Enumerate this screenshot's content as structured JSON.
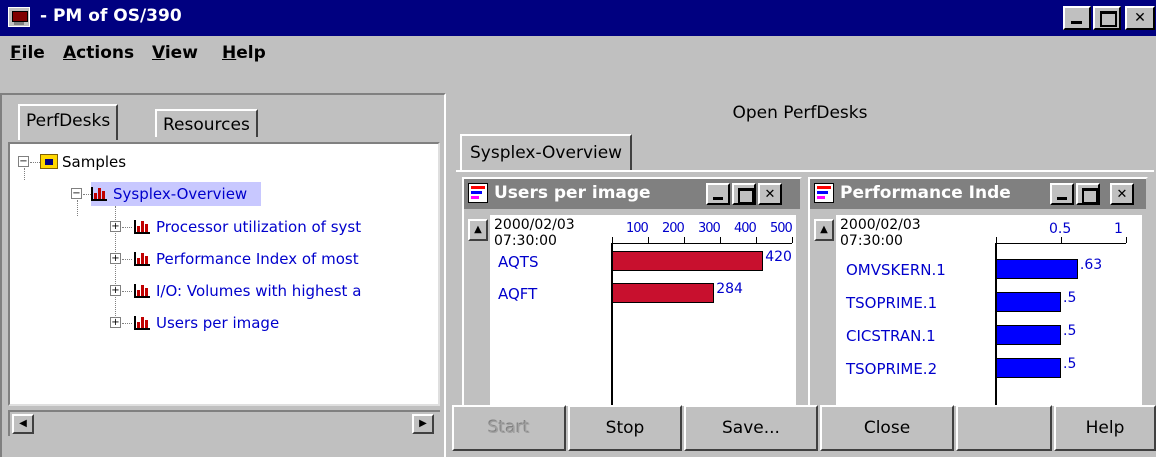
{
  "window": {
    "title": "- PM of OS/390"
  },
  "menu": [
    {
      "key": "F",
      "rest": "ile"
    },
    {
      "key": "A",
      "rest": "ctions"
    },
    {
      "key": "V",
      "rest": "iew"
    },
    {
      "key": "H",
      "rest": "elp"
    }
  ],
  "left": {
    "tabs": [
      "PerfDesks",
      "Resources"
    ],
    "tree": {
      "root": "Samples",
      "desk": "Sysplex-Overview",
      "items": [
        "Processor utilization of syst",
        "Performance Index of most",
        "I/O: Volumes with highest a",
        "Users per image"
      ]
    }
  },
  "right": {
    "title": "Open PerfDesks",
    "tab": "Sysplex-Overview",
    "charts": [
      {
        "title": "Users per image",
        "timestamp_date": "2000/02/03",
        "timestamp_time": "07:30:00",
        "tick_labels": [
          "100",
          "200",
          "300",
          "400",
          "500"
        ],
        "bar_color": "#c8102e"
      },
      {
        "title": "Performance Inde",
        "timestamp_date": "2000/02/03",
        "timestamp_time": "07:30:00",
        "tick_labels": [
          "0.5",
          "1"
        ],
        "bar_color": "#0000ff"
      }
    ]
  },
  "chart_data": [
    {
      "type": "bar",
      "title": "Users per image",
      "categories": [
        "AQTS",
        "AQFT"
      ],
      "values": [
        420,
        284
      ],
      "value_labels": [
        "420",
        "284"
      ],
      "xlim": [
        0,
        500
      ]
    },
    {
      "type": "bar",
      "title": "Performance Inde",
      "categories": [
        "OMVSKERN.1",
        "TSOPRIME.1",
        "CICSTRAN.1",
        "TSOPRIME.2"
      ],
      "values": [
        0.63,
        0.5,
        0.5,
        0.5
      ],
      "value_labels": [
        ".63",
        ".5",
        ".5",
        ".5"
      ],
      "xlim": [
        0,
        1
      ]
    }
  ],
  "buttons": {
    "start": "Start",
    "stop": "Stop",
    "save": "Save...",
    "close": "Close",
    "help": "Help"
  }
}
